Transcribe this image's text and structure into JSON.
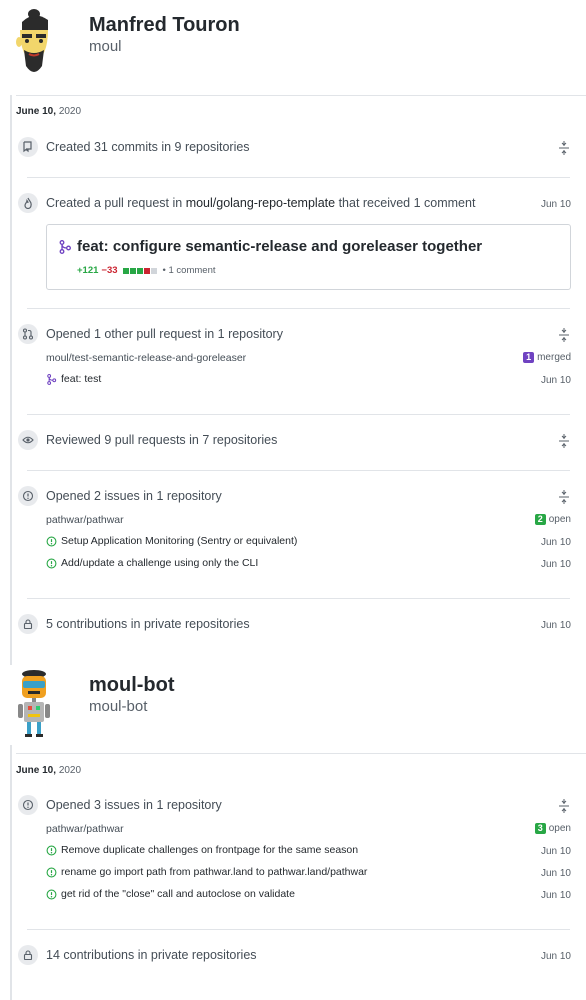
{
  "profiles": [
    {
      "name": "Manfred Touron",
      "login": "moul",
      "date": {
        "month_day": "June 10,",
        "year": "2020"
      },
      "sections": {
        "commits": {
          "icon": "repo-push-icon",
          "title": "Created 31 commits in 9 repositories"
        },
        "created_pr": {
          "icon": "flame-icon",
          "title_prefix": "Created a pull request in",
          "repo": "moul/golang-repo-template",
          "title_suffix": "that received 1 comment",
          "date": "Jun 10",
          "card": {
            "icon": "git-merge-icon",
            "title": "feat: configure semantic-release and goreleaser together",
            "additions": "+121",
            "deletions": "−33",
            "comments": "• 1 comment"
          }
        },
        "opened_pr": {
          "icon": "git-pull-request-icon",
          "title": "Opened 1 other pull request in 1 repository",
          "repo": "moul/test-semantic-release-and-goreleaser",
          "count": "1",
          "state": "merged",
          "items": [
            {
              "icon": "git-merge-icon",
              "title": "feat: test",
              "date": "Jun 10"
            }
          ]
        },
        "reviewed": {
          "icon": "eye-icon",
          "title": "Reviewed 9 pull requests in 7 repositories"
        },
        "issues": {
          "icon": "issue-opened-icon",
          "title": "Opened 2 issues in 1 repository",
          "repo": "pathwar/pathwar",
          "count": "2",
          "state": "open",
          "items": [
            {
              "title": "Setup Application Monitoring (Sentry or equivalent)",
              "date": "Jun 10"
            },
            {
              "title": "Add/update a challenge using only the CLI",
              "date": "Jun 10"
            }
          ]
        },
        "private": {
          "icon": "lock-icon",
          "title": "5 contributions in private repositories",
          "date": "Jun 10"
        }
      }
    },
    {
      "name": "moul-bot",
      "login": "moul-bot",
      "date": {
        "month_day": "June 10,",
        "year": "2020"
      },
      "sections": {
        "issues": {
          "icon": "issue-opened-icon",
          "title": "Opened 3 issues in 1 repository",
          "repo": "pathwar/pathwar",
          "count": "3",
          "state": "open",
          "items": [
            {
              "title": "Remove duplicate challenges on frontpage for the same season",
              "date": "Jun 10"
            },
            {
              "title": "rename go import path from pathwar.land to pathwar.land/pathwar",
              "date": "Jun 10"
            },
            {
              "title": "get rid of the \"close\" call and autoclose on validate",
              "date": "Jun 10"
            }
          ]
        },
        "private": {
          "icon": "lock-icon",
          "title": "14 contributions in private repositories",
          "date": "Jun 10"
        }
      }
    }
  ],
  "colors": {
    "merged": "#6f42c1",
    "open": "#28a745",
    "additions": "#28a745",
    "deletions": "#cb2431",
    "neutral": "#d1d5da"
  }
}
